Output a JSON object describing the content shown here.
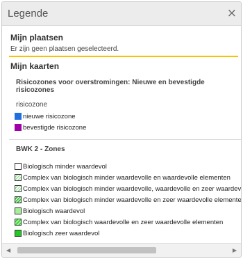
{
  "header": {
    "title": "Legende",
    "close_glyph": "×"
  },
  "places": {
    "title": "Mijn plaatsen",
    "empty_text": "Er zijn geen plaatsen geselecteerd."
  },
  "maps": {
    "title": "Mijn kaarten",
    "risk_layer": {
      "title": "Risicozones voor overstromingen: Nieuwe en bevestigde risicozones",
      "caption": "risicozone",
      "items": [
        {
          "label": "nieuwe risicozone",
          "color": "#1f6fde"
        },
        {
          "label": "bevestigde risicozone",
          "color": "#a000a8"
        }
      ]
    },
    "bwk_layer": {
      "title": "BWK 2 - Zones",
      "items": [
        {
          "label": "Biologisch minder waardevol",
          "pattern": "blank",
          "fill": "#ffffff"
        },
        {
          "label": "Complex van biologisch minder waardevolle en waardevolle elementen",
          "pattern": "hatch-light",
          "fill": "#9be39b"
        },
        {
          "label": "Complex van biologisch minder waardevolle, waardevolle en zeer waardevolle elementen",
          "pattern": "hatch-sparse",
          "fill": "#6ccf6c"
        },
        {
          "label": "Complex van biologisch minder waardevolle en zeer waardevolle elementen",
          "pattern": "hatch-dense",
          "fill": "#3fbf3f"
        },
        {
          "label": "Biologisch waardevol",
          "pattern": "solid",
          "fill": "#a6ef9a"
        },
        {
          "label": "Complex van biologisch waardevolle en zeer waardevolle elementen",
          "pattern": "hatch-green",
          "fill": "#33d133"
        },
        {
          "label": "Biologisch zeer waardevol",
          "pattern": "solid",
          "fill": "#22c922"
        }
      ]
    }
  },
  "scroll": {
    "left_glyph": "◀",
    "right_glyph": "▶"
  },
  "colors": {
    "accent_line": "#f5c400"
  }
}
